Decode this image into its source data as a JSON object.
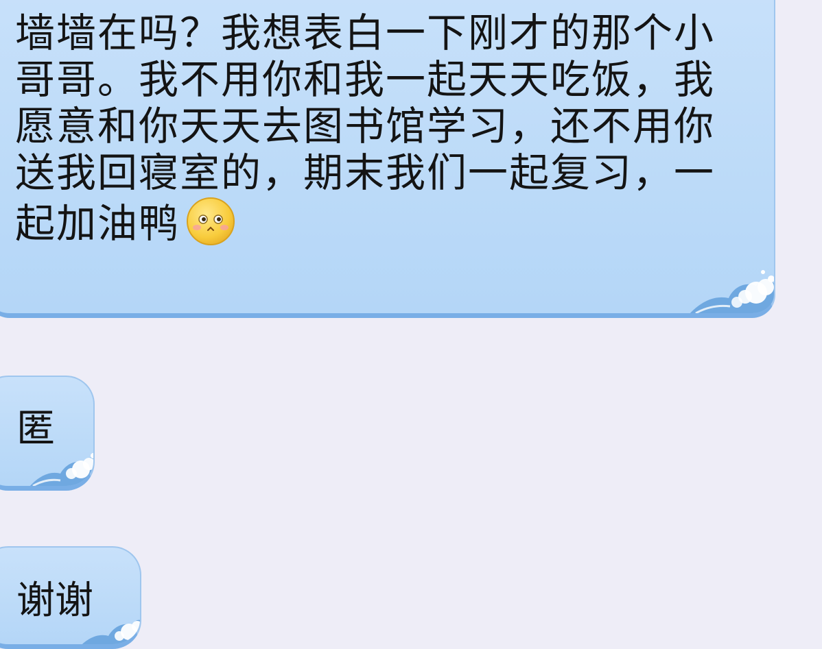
{
  "messages": [
    {
      "text": "墙墙在吗？我想表白一下刚才的那个小哥哥。我不用你和我一起天天吃饭，我愿意和你天天去图书馆学习，还不用你送我回寝室的，期末我们一起复习，一起加油鸭",
      "emoji": "shy-face-icon"
    },
    {
      "text": "匿"
    },
    {
      "text": "谢谢"
    }
  ],
  "colors": {
    "background": "#eeedf7",
    "bubble_fill": "#c4dff9",
    "bubble_border": "#79aee6",
    "text": "#141414"
  }
}
